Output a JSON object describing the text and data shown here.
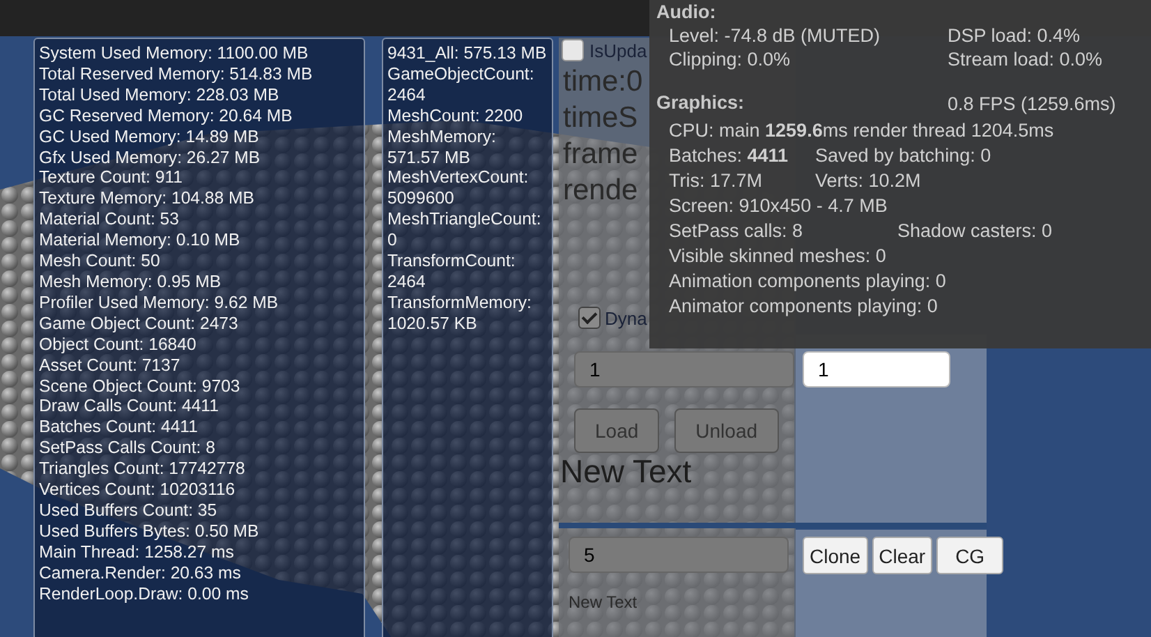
{
  "memory_panel": {
    "lines": [
      "System Used Memory: 1100.00 MB",
      "Total Reserved Memory: 514.83 MB",
      "Total Used Memory: 228.03 MB",
      "GC Reserved Memory: 20.64 MB",
      "GC Used Memory: 14.89 MB",
      "Gfx Used Memory: 26.27 MB",
      "Texture Count: 911",
      "Texture Memory: 104.88 MB",
      "Material Count: 53",
      "Material Memory: 0.10 MB",
      "Mesh Count: 50",
      "Mesh Memory: 0.95 MB",
      "Profiler Used Memory: 9.62 MB",
      "Game Object Count: 2473",
      "Object Count: 16840",
      "Asset Count: 7137",
      "Scene Object Count: 9703",
      "Draw Calls Count: 4411",
      "Batches Count: 4411",
      "SetPass Calls Count: 8",
      "Triangles Count: 17742778",
      "Vertices Count: 10203116",
      "Used Buffers Count: 35",
      "Used Buffers Bytes: 0.50 MB",
      "Main Thread: 1258.27 ms",
      "Camera.Render: 20.63 ms",
      "RenderLoop.Draw: 0.00 ms"
    ]
  },
  "mesh_panel": {
    "lines": [
      "9431_All: 575.13 MB",
      "GameObjectCount: 2464",
      "MeshCount: 2200",
      "MeshMemory: 571.57 MB",
      "MeshVertexCount: 5099600",
      "MeshTriangleCount: 0",
      "TransformCount: 2464",
      "TransformMemory: 1020.57 KB"
    ]
  },
  "controls": {
    "update_toggle": {
      "label": "IsUpda",
      "checked": false
    },
    "labels": [
      "time:0",
      "timeS",
      "frame",
      "rende"
    ],
    "dynamic_toggle": {
      "label": "Dyna",
      "checked": true
    },
    "count_field": {
      "value": "1"
    },
    "second_field": {
      "value": "1"
    },
    "buttons": [
      "Load",
      "Unload"
    ],
    "heading": "New Text",
    "clone_field": {
      "value": "5"
    },
    "clone_buttons": [
      "Clone",
      "Clear",
      "CG"
    ],
    "caption": "New Text"
  },
  "stats": {
    "audio": {
      "title": "Audio:",
      "rows": [
        [
          "Level: -74.8 dB (MUTED)",
          "DSP load: 0.4%"
        ],
        [
          "Clipping: 0.0%",
          "Stream load: 0.0%"
        ]
      ]
    },
    "graphics": {
      "title": "Graphics:",
      "fps": "0.8 FPS (1259.6ms)",
      "rows": [
        [
          "CPU: main **1259.6**ms  render thread 1204.5ms"
        ],
        [
          "Batches: **4411**",
          "Saved by batching: 0"
        ],
        [
          "Tris: 17.7M",
          "Verts: 10.2M"
        ],
        [
          "Screen: 910x450 - 4.7 MB"
        ],
        [
          "SetPass calls: 8",
          "Shadow casters: 0"
        ],
        [
          "Visible skinned meshes: 0"
        ],
        [
          "Animation components playing: 0"
        ],
        [
          "Animator components playing: 0"
        ]
      ]
    }
  }
}
